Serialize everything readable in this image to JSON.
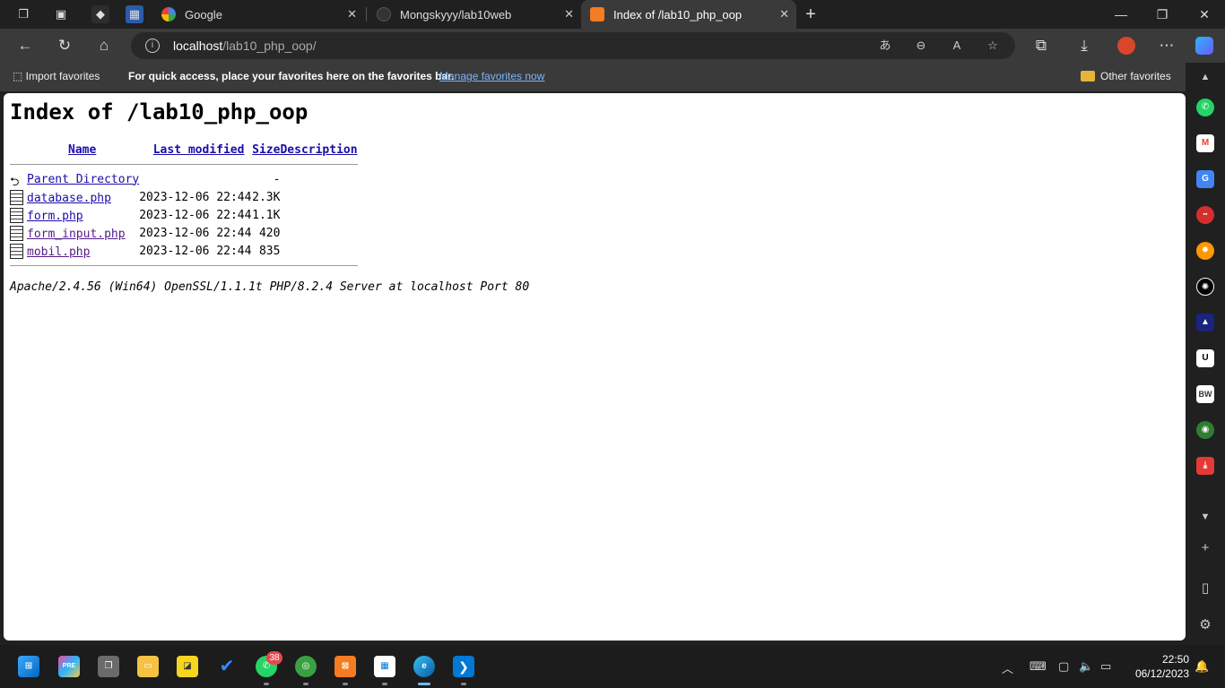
{
  "tabs": [
    {
      "title": "Google",
      "favicon": "google-icon"
    },
    {
      "title": "Mongskyyy/lab10web",
      "favicon": "github-icon"
    },
    {
      "title": "Index of /lab10_php_oop",
      "favicon": "xampp-icon",
      "active": true
    }
  ],
  "address_bar": {
    "host": "localhost",
    "path": "/lab10_php_oop/"
  },
  "favorites_bar": {
    "import_label": "Import favorites",
    "quick_access_text": "For quick access, place your favorites here on the favorites bar.",
    "manage_link": "Manage favorites now",
    "other_favorites": "Other favorites"
  },
  "page": {
    "heading": "Index of /lab10_php_oop",
    "columns": {
      "name": "Name",
      "last_modified": "Last modified",
      "size": "Size",
      "description": "Description"
    },
    "parent": {
      "label": "Parent Directory",
      "size": "-"
    },
    "files": [
      {
        "name": "database.php",
        "modified": "2023-12-06 22:44",
        "size": "2.3K"
      },
      {
        "name": "form.php",
        "modified": "2023-12-06 22:44",
        "size": "1.1K"
      },
      {
        "name": "form_input.php",
        "modified": "2023-12-06 22:44",
        "size": "420"
      },
      {
        "name": "mobil.php",
        "modified": "2023-12-06 22:44",
        "size": "835"
      }
    ],
    "server_signature": "Apache/2.4.56 (Win64) OpenSSL/1.1.1t PHP/8.2.4 Server at localhost Port 80"
  },
  "taskbar": {
    "whatsapp_badge": "38",
    "clock_time": "22:50",
    "clock_date": "06/12/2023"
  },
  "colors": {
    "link": "#1a0dab",
    "visited_link": "#551a8b",
    "accent_manage_link": "#7ab6ff"
  }
}
